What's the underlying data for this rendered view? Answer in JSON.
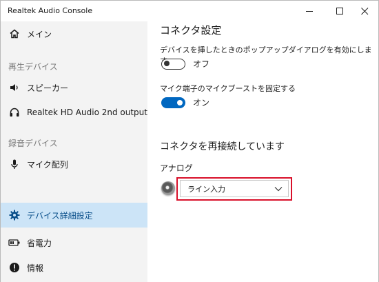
{
  "window": {
    "title": "Realtek Audio Console"
  },
  "sidebar": {
    "main": "メイン",
    "playback_section": "再生デバイス",
    "playback": [
      "スピーカー",
      "Realtek HD Audio 2nd output"
    ],
    "record_section": "録音デバイス",
    "record": [
      "マイク配列"
    ],
    "advanced": "デバイス詳細設定",
    "power": "省電力",
    "info": "情報"
  },
  "content": {
    "connector_title": "コネクタ設定",
    "popup_desc": "デバイスを挿したときのポップアップダイアログを有効にします。",
    "popup_state": "オフ",
    "mic_boost_desc": "マイク端子のマイクブーストを固定する",
    "mic_boost_state": "オン",
    "reconnect_title": "コネクタを再接続しています",
    "analog_label": "アナログ",
    "line_in_value": "ライン入力"
  },
  "colors": {
    "accent": "#0067c0",
    "selected_bg": "#cce4f7",
    "highlight": "#d9102a"
  }
}
